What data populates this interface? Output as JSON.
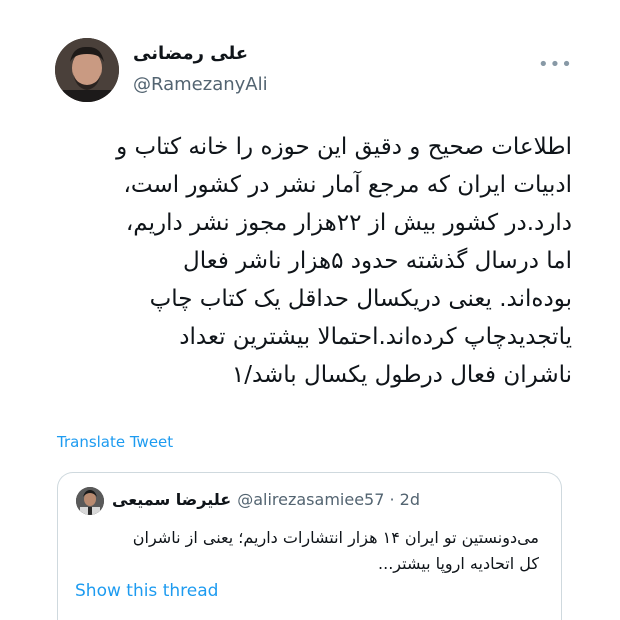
{
  "tweet": {
    "author": {
      "name": "علی رمضانی",
      "handle": "@RamezanyAli"
    },
    "body_lines": [
      "اطلاعات صحیح و دقیق این حوزه را خانه کتاب و",
      "ادبیات ایران که مرجع آمار نشر در کشور است،",
      "دارد.در کشور بیش از ۲۲هزار مجوز نشر داریم،",
      "اما درسال گذشته حدود ۵هزار ناشر فعال",
      "بوده‌اند. یعنی دریکسال حداقل یک کتاب چاپ",
      "یاتجدیدچاپ کرده‌اند.احتمالا بیشترین تعداد",
      "ناشران فعال درطول یکسال باشد/۱"
    ],
    "translate_label": "Translate Tweet",
    "more_icon": "more-dots-icon"
  },
  "quote": {
    "name": "علیرضا سمیعی",
    "handle": "@alirezasamiee57",
    "separator": "·",
    "time": "2d",
    "body_lines": [
      "می‌دونستین تو ایران ۱۴ هزار انتشارات داریم؛ یعنی از ناشران",
      "کل اتحادیه اروپا بیشتر..."
    ],
    "show_thread_label": "Show this thread"
  },
  "colors": {
    "link": "#1d9bf0",
    "secondary_text": "#536471",
    "border": "#cfd9de"
  }
}
